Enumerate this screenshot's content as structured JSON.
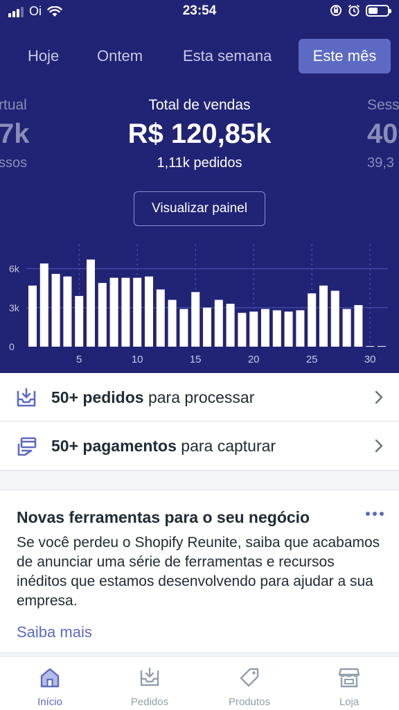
{
  "status_bar": {
    "carrier": "Oi",
    "time": "23:54"
  },
  "period_tabs": [
    {
      "label": "Hoje",
      "active": false
    },
    {
      "label": "Ontem",
      "active": false
    },
    {
      "label": "Esta semana",
      "active": false
    },
    {
      "label": "Este mês",
      "active": true
    }
  ],
  "metrics": {
    "left_partial": {
      "label": "rtual",
      "value": "7k",
      "sub": "ssos"
    },
    "center": {
      "label": "Total de vendas",
      "value": "R$ 120,85k",
      "sub": "1,11k pedidos"
    },
    "right_partial": {
      "label": "Sess",
      "value": "40",
      "sub": "39,3"
    }
  },
  "view_panel_label": "Visualizar painel",
  "chart_data": {
    "type": "bar",
    "x": [
      1,
      2,
      3,
      4,
      5,
      6,
      7,
      8,
      9,
      10,
      11,
      12,
      13,
      14,
      15,
      16,
      17,
      18,
      19,
      20,
      21,
      22,
      23,
      24,
      25,
      26,
      27,
      28,
      29,
      30,
      31
    ],
    "values": [
      4.7,
      6.4,
      5.6,
      5.4,
      3.9,
      6.7,
      4.9,
      5.3,
      5.3,
      5.3,
      5.4,
      4.4,
      3.6,
      2.9,
      4.2,
      3.0,
      3.6,
      3.3,
      2.6,
      2.7,
      2.9,
      2.8,
      2.7,
      2.8,
      4.1,
      4.7,
      4.3,
      2.9,
      3.2,
      0.05,
      0.05
    ],
    "x_ticks": [
      5,
      10,
      15,
      20,
      25,
      30
    ],
    "y_ticks": [
      0,
      3,
      6
    ],
    "y_tick_labels": [
      "0",
      "3k",
      "6k"
    ],
    "ylim": [
      0,
      8
    ],
    "bar_color": "#ffffff",
    "grid_color": "#4a4fb0",
    "weekly_markers": [
      5,
      10,
      15,
      20,
      25,
      30
    ]
  },
  "action_rows": [
    {
      "icon": "inbox-download-icon",
      "bold": "50+ pedidos",
      "rest": " para processar"
    },
    {
      "icon": "payments-icon",
      "bold": "50+ pagamentos",
      "rest": " para capturar"
    }
  ],
  "news_card": {
    "title": "Novas ferramentas para o seu negócio",
    "body": "Se você perdeu o Shopify Reunite, saiba que acabamos de anunciar uma série de ferramentas e recursos inéditos que estamos desenvolvendo para ajudar a sua empresa.",
    "link": "Saiba mais"
  },
  "bottom_nav": [
    {
      "label": "Início",
      "icon": "home-icon",
      "active": true
    },
    {
      "label": "Pedidos",
      "icon": "orders-icon",
      "active": false
    },
    {
      "label": "Produtos",
      "icon": "tag-icon",
      "active": false
    },
    {
      "label": "Loja",
      "icon": "store-icon",
      "active": false
    }
  ],
  "colors": {
    "header_bg": "#212375",
    "accent": "#5c6ac4",
    "text": "#212b36",
    "muted": "#919eab"
  }
}
